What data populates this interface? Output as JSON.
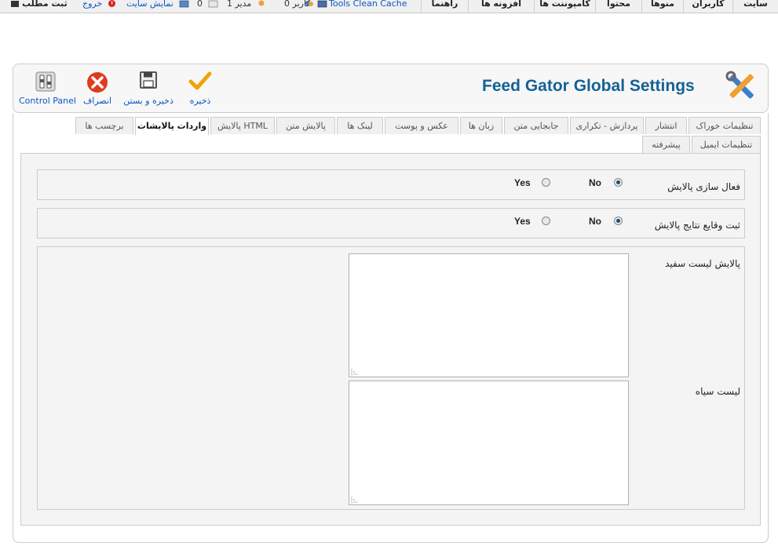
{
  "topmenu": {
    "items": [
      "سایت",
      "کاربران",
      "منوها",
      "محتوا",
      "کامپوننت ها",
      "افزونه ها",
      "راهنما"
    ]
  },
  "status": {
    "cache": "Tools Clean Cache",
    "users_count": "0 کاربر",
    "admins_count": "1 مدیر",
    "messages_count": "0",
    "view_site": "نمایش سایت",
    "logout": "خروج",
    "new_article": "ثبت مطلب"
  },
  "toolbar": {
    "title": "Feed Gator Global Settings",
    "save": "ذخیره",
    "save_close": "ذخیره و بستن",
    "cancel": "انصراف",
    "control_panel": "Control Panel"
  },
  "tabs": {
    "row1": [
      "تنظیمات خوراک",
      "انتشار",
      "پردازش - تکراری",
      "جابجایی متن",
      "زبان ها",
      "عکس و پوست",
      "لینک ها",
      "پالایش متن",
      "پالایش HTML",
      "واردات پالایشات",
      "برچسب ها"
    ],
    "row2": [
      "تنظیمات ایمیل",
      "پیشرفته"
    ],
    "active": "واردات پالایشات"
  },
  "form": {
    "enable_filtering": {
      "label": "فعال سازی پالایش",
      "no": "No",
      "yes": "Yes",
      "selected": "No"
    },
    "log_filter_results": {
      "label": "ثبت وقایع نتایج پالایش",
      "no": "No",
      "yes": "Yes",
      "selected": "No"
    },
    "whitelist": {
      "label": "پالایش لیست سفید",
      "value": ""
    },
    "blacklist": {
      "label": "لیست سیاه",
      "value": ""
    }
  },
  "colors": {
    "title": "#146295",
    "link": "#0b55c4",
    "check": "#f0a30a",
    "cancel": "#e03a1e"
  }
}
